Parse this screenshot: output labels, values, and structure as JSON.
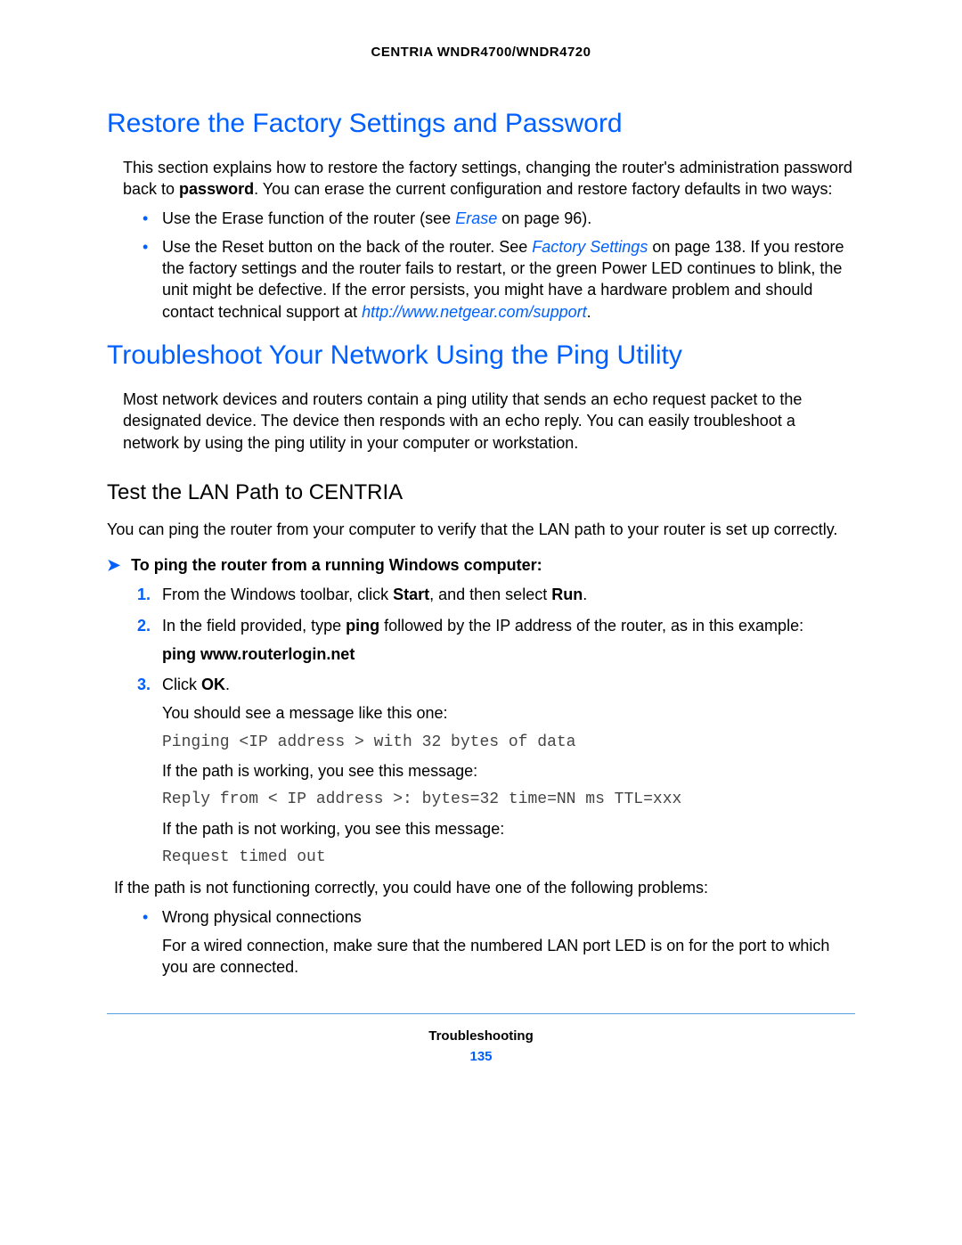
{
  "header": {
    "title": "CENTRIA WNDR4700/WNDR4720"
  },
  "section1": {
    "title": "Restore the Factory Settings and Password",
    "intro_pre": "This section explains how to restore the factory settings, changing the router's administration password back to ",
    "intro_bold": "password",
    "intro_post": ". You can erase the current configuration and restore factory defaults in two ways:",
    "bullets": [
      {
        "pre": "Use the Erase function of the router (see ",
        "link": "Erase",
        "post": " on page 96)."
      },
      {
        "pre": "Use the Reset button on the back of the router. See ",
        "link": "Factory Settings",
        "mid": " on page 138. If you restore the factory settings and the router fails to restart, or the green Power LED continues to blink, the unit might be defective. If the error persists, you might have a hardware problem and should contact technical support at ",
        "url": "http://www.netgear.com/support",
        "tail": "."
      }
    ]
  },
  "section2": {
    "title": "Troubleshoot Your Network Using the Ping Utility",
    "intro": "Most network devices and routers contain a ping utility that sends an echo request packet to the designated device. The device then responds with an echo reply. You can easily troubleshoot a network by using the ping utility in your computer or workstation.",
    "sub": {
      "title": "Test the LAN Path to CENTRIA",
      "intro": "You can ping the router from your computer to verify that the LAN path to your router is set up correctly.",
      "proc_title": "To ping the router from a running Windows computer:",
      "steps": {
        "s1_pre": "From the Windows toolbar, click ",
        "s1_b1": "Start",
        "s1_mid": ", and then select ",
        "s1_b2": "Run",
        "s1_post": ".",
        "s2_pre": "In the field provided, type ",
        "s2_b": "ping",
        "s2_post": " followed by the IP address of the router, as in this example:",
        "s2_cmd": "ping www.routerlogin.net",
        "s3_pre": "Click ",
        "s3_b": "OK",
        "s3_post": ".",
        "s3_line1": "You should see a message like this one:",
        "s3_code1": "Pinging <IP address > with 32 bytes of data",
        "s3_line2": "If the path is working, you see this message:",
        "s3_code2": "Reply from < IP address >: bytes=32 time=NN ms TTL=xxx",
        "s3_line3": "If the path is not working, you see this message:",
        "s3_code3": "Request timed out"
      },
      "after": "If the path is not functioning correctly, you could have one of the following problems:",
      "problems": [
        {
          "head": "Wrong physical connections",
          "desc": "For a wired connection, make sure that the numbered LAN port LED is on for the port to which you are connected."
        }
      ]
    }
  },
  "footer": {
    "section": "Troubleshooting",
    "page": "135"
  }
}
